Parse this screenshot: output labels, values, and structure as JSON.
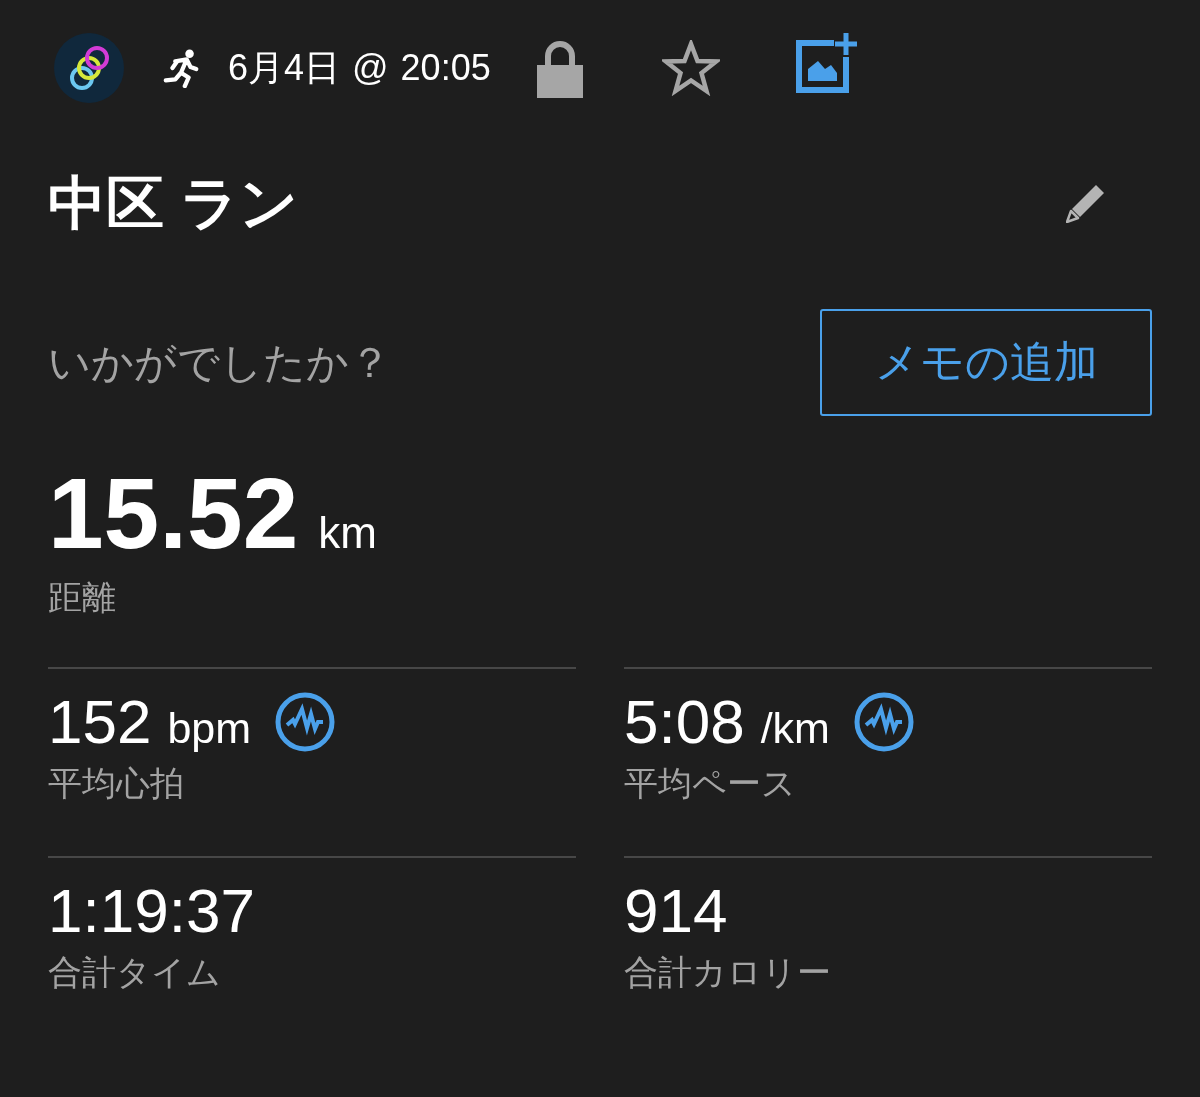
{
  "header": {
    "activity_time": "6月4日 @ 20:05",
    "favorite": false
  },
  "title": "中区 ラン",
  "feedback": {
    "prompt": "いかがでしたか？",
    "button": "メモの追加"
  },
  "distance": {
    "value": "15.52",
    "unit": "km",
    "label": "距離"
  },
  "stats": [
    {
      "value": "152",
      "unit": "bpm",
      "label": "平均心拍",
      "has_chart": true
    },
    {
      "value": "5:08",
      "unit": "/km",
      "label": "平均ペース",
      "has_chart": true
    },
    {
      "value": "1:19:37",
      "label": "合計タイム",
      "has_chart": false
    },
    {
      "value": "914",
      "label": "合計カロリー",
      "has_chart": false
    }
  ]
}
